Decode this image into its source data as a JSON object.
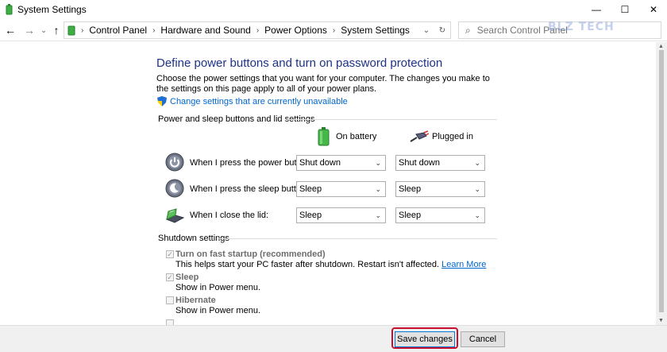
{
  "window": {
    "title": "System Settings",
    "controls": {
      "minimize": "—",
      "maximize": "☐",
      "close": "✕"
    }
  },
  "address": {
    "breadcrumbs": [
      "Control Panel",
      "Hardware and Sound",
      "Power Options",
      "System Settings"
    ],
    "search_placeholder": "Search Control Panel",
    "watermark": "BLZ TECH"
  },
  "main": {
    "heading": "Define power buttons and turn on password protection",
    "description": "Choose the power settings that you want for your computer. The changes you make to the settings on this page apply to all of your power plans.",
    "change_link": "Change settings that are currently unavailable",
    "power_section": {
      "title": "Power and sleep buttons and lid settings",
      "col_battery": "On battery",
      "col_plugged": "Plugged in",
      "rows": [
        {
          "label": "When I press the power button:",
          "battery": "Shut down",
          "plugged": "Shut down"
        },
        {
          "label": "When I press the sleep button:",
          "battery": "Sleep",
          "plugged": "Sleep"
        },
        {
          "label": "When I close the lid:",
          "battery": "Sleep",
          "plugged": "Sleep"
        }
      ]
    },
    "shutdown_section": {
      "title": "Shutdown settings",
      "items": [
        {
          "title": "Turn on fast startup (recommended)",
          "desc": "This helps start your PC faster after shutdown. Restart isn't affected.",
          "link": "Learn More",
          "checked": true
        },
        {
          "title": "Sleep",
          "desc": "Show in Power menu.",
          "checked": true
        },
        {
          "title": "Hibernate",
          "desc": "Show in Power menu.",
          "checked": false
        }
      ]
    }
  },
  "footer": {
    "save": "Save changes",
    "cancel": "Cancel"
  },
  "colors": {
    "heading": "#1e3287",
    "link": "#0066cc",
    "highlight": "#c8102e"
  }
}
